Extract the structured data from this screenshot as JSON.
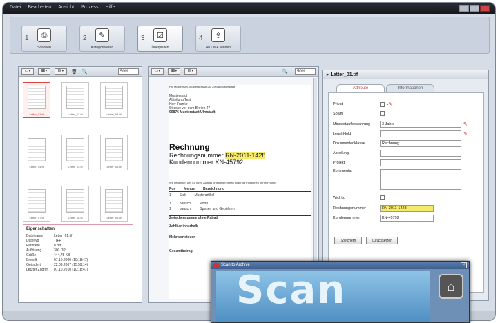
{
  "menu": [
    "Datei",
    "Bearbeiten",
    "Ansicht",
    "Prozess",
    "Hilfe"
  ],
  "steps": [
    {
      "num": "1",
      "label": "Scannen",
      "icon": "scanner-icon"
    },
    {
      "num": "2",
      "label": "Kategorisieren",
      "icon": "edit-icon"
    },
    {
      "num": "3",
      "label": "Überprüfen",
      "icon": "check-icon"
    },
    {
      "num": "4",
      "label": "An DMA senden",
      "icon": "send-icon"
    }
  ],
  "left_panel": {
    "zoom": "50%",
    "thumbs": [
      "Letter_01.tif",
      "Letter_02.tif",
      "Letter_03.tif",
      "Letter_04.tif",
      "Letter_05.tif",
      "Letter_06.tif",
      "Letter_07.tif",
      "Letter_08.tif",
      "Letter_09.tif"
    ],
    "props": {
      "header": "Eigenschaften",
      "rows": [
        {
          "k": "Dateiname",
          "v": "Letter_01.tif"
        },
        {
          "k": "Dateityp",
          "v": "TIFF"
        },
        {
          "k": "Farbtiefe",
          "v": "8 Bit"
        },
        {
          "k": "Auflösung",
          "v": "300 DPI"
        },
        {
          "k": "Größe",
          "v": "444,75 KB"
        },
        {
          "k": "Erstellt",
          "v": "07.10.2009 (10:18:47)"
        },
        {
          "k": "Geändert",
          "v": "22.09.2007 (15:59:14)"
        },
        {
          "k": "Letzter Zugriff",
          "v": "07.10.2010 (10:18:47)"
        }
      ]
    }
  },
  "doc_panel": {
    "zoom": "50%",
    "sender": "Fa. Musterman, Musterstrasse 25, 29018 Musterstadt",
    "recipient": [
      "Musterstadt",
      "Abteilung Test",
      "Herr Franke",
      "Strasse vor dem Breien 27",
      "99876 Musterstadt Ulmstadt"
    ],
    "title": "Rechnung",
    "rn_label": "Rechnungsnummer",
    "rn_value": "RN-2011-1428",
    "kn_label": "Kundennummer",
    "kn_value": "KN-45792",
    "intro": "Wir bedanken uns für Ihren Auftrag und stellen Ihnen folgende Positionen in Rechnung:",
    "table_head": [
      "Pos",
      "Menge",
      "Bezeichnung"
    ],
    "table_rows": [
      [
        "1",
        "Stck",
        "Musterartikel"
      ],
      [
        "1",
        "pausch.",
        "Porto"
      ],
      [
        "1",
        "pausch.",
        "Spesen und Gebühren"
      ]
    ],
    "footer": [
      "Zwischensumme ohne Rabatt",
      "Zahlbar innerhalb",
      "Mehrwertsteuer",
      "Gesamtbetrag"
    ]
  },
  "form_panel": {
    "header": "Letter_01.tif",
    "tabs": [
      "Attribute",
      "Informationen"
    ],
    "fields": [
      {
        "k": "Privat",
        "v": ""
      },
      {
        "k": "Spam",
        "v": ""
      },
      {
        "k": "Mindestaufbewahrung",
        "v": "3 Jahre"
      },
      {
        "k": "Legal Hold",
        "v": ""
      },
      {
        "k": "Dokumentenklasse",
        "v": "Rechnung"
      },
      {
        "k": "Abteilung",
        "v": ""
      },
      {
        "k": "Projekt",
        "v": ""
      },
      {
        "k": "Kommentar",
        "v": ""
      },
      {
        "k": "Wichtig",
        "v": ""
      },
      {
        "k": "Rechnungsnummer",
        "v": "RN-2011-1428"
      },
      {
        "k": "Kundennummer",
        "v": "KN-45792"
      }
    ],
    "buttons": [
      "Speichern",
      "Zurücksetzen"
    ]
  },
  "dialog": {
    "title": "Scan to Archive",
    "word": "Scan"
  },
  "colors": {
    "accent": "#c33333",
    "highlight": "#f6ea6b",
    "dialog": "#4f8fc3"
  }
}
